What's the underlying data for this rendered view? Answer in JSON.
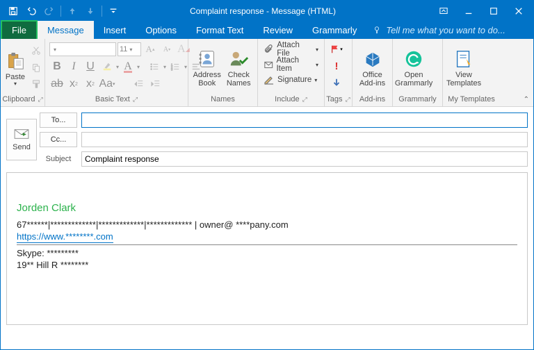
{
  "title": "Complaint response - Message (HTML)",
  "tabs": {
    "file": "File",
    "message": "Message",
    "insert": "Insert",
    "options": "Options",
    "formattext": "Format Text",
    "review": "Review",
    "grammarly": "Grammarly",
    "tellme": "Tell me what you want to do..."
  },
  "ribbon": {
    "clipboard": {
      "label": "Clipboard",
      "paste": "Paste"
    },
    "basictext": {
      "label": "Basic Text",
      "fontname": "",
      "fontsize": "11"
    },
    "names": {
      "label": "Names",
      "address": "Address\nBook",
      "check": "Check\nNames"
    },
    "include": {
      "label": "Include",
      "attachfile": "Attach File",
      "attachitem": "Attach Item",
      "signature": "Signature"
    },
    "tags": {
      "label": "Tags"
    },
    "addins": {
      "label": "Add-ins",
      "office": "Office\nAdd-ins"
    },
    "grammarlyg": {
      "label": "Grammarly",
      "open": "Open\nGrammarly"
    },
    "mytemplates": {
      "label": "My Templates",
      "view": "View\nTemplates"
    }
  },
  "envelope": {
    "send": "Send",
    "to": "To...",
    "cc": "Cc...",
    "subjectLabel": "Subject",
    "toValue": "",
    "ccValue": "",
    "subjectValue": "Complaint response"
  },
  "body": {
    "name": "Jorden Clark",
    "line1": "67******|*************|*************|*************  | owner@ ****pany.com",
    "website": "https://www.********.com",
    "skype": "Skype:  *********",
    "addr": "19** Hill R ********"
  }
}
